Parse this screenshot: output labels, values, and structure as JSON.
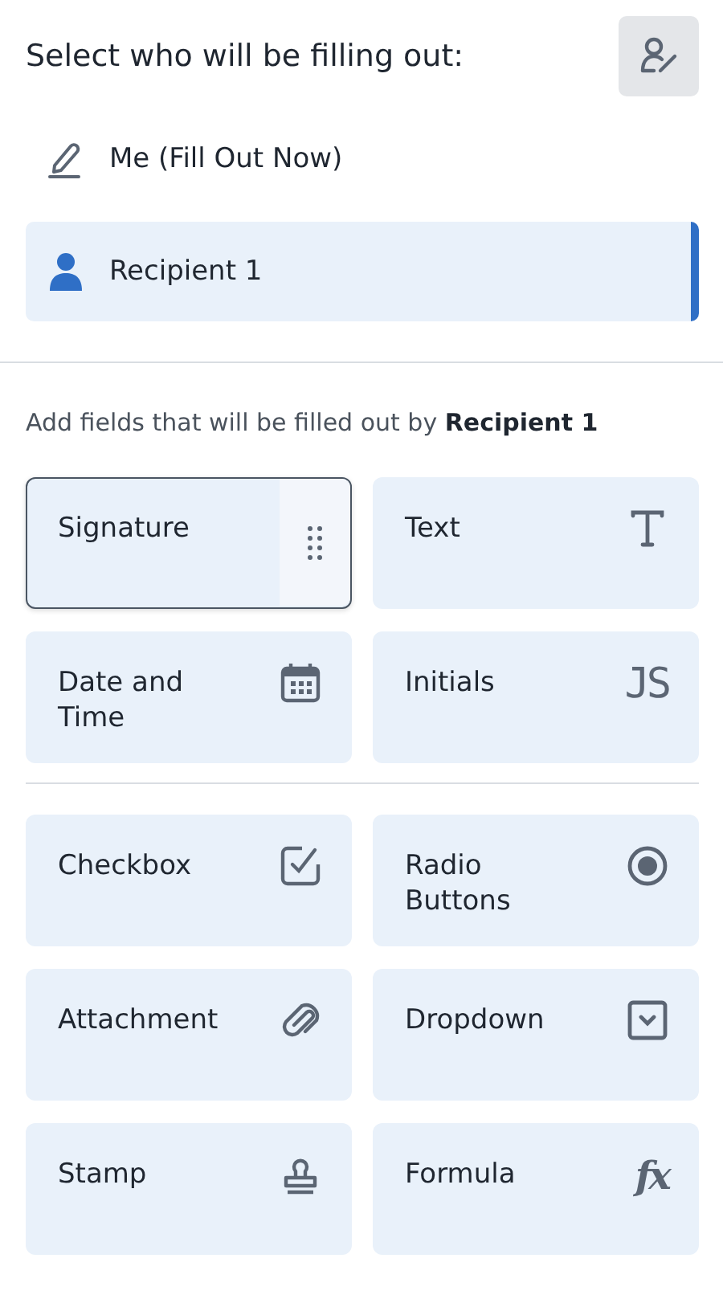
{
  "heading": "Select who will be filling out:",
  "signers": [
    {
      "kind": "me",
      "label": "Me (Fill Out Now)",
      "selected": false
    },
    {
      "kind": "recipient",
      "label": "Recipient 1",
      "selected": true
    }
  ],
  "instruction": "Add fields that will be filled out by **Recipient 1**",
  "field_groups": [
    [
      {
        "kind": "signature",
        "label": "Signature",
        "selected": true
      },
      {
        "kind": "text",
        "label": "Text",
        "selected": false
      },
      {
        "kind": "date",
        "label": "Date and Time",
        "selected": false
      },
      {
        "kind": "initials",
        "label": "Initials",
        "icon_text": "JS",
        "selected": false
      }
    ],
    [
      {
        "kind": "checkbox",
        "label": "Checkbox",
        "selected": false
      },
      {
        "kind": "radio",
        "label": "Radio Buttons",
        "selected": false
      },
      {
        "kind": "attachment",
        "label": "Attachment",
        "selected": false
      },
      {
        "kind": "dropdown",
        "label": "Dropdown",
        "selected": false
      },
      {
        "kind": "stamp",
        "label": "Stamp",
        "selected": false
      },
      {
        "kind": "formula",
        "label": "Formula",
        "icon_text": "fx",
        "selected": false
      }
    ]
  ]
}
